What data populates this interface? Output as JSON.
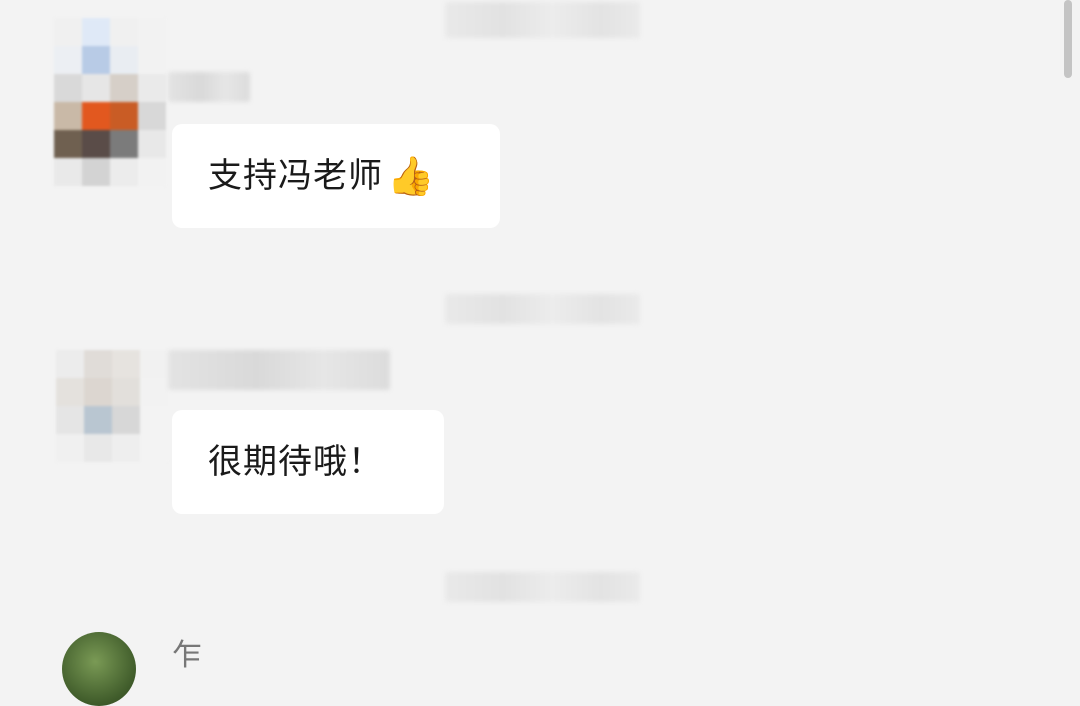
{
  "messages": [
    {
      "text": "支持冯老师",
      "emoji": "👍"
    },
    {
      "text": "很期待哦！"
    }
  ],
  "partial_next": {
    "name_glyph": "乍"
  },
  "colors": {
    "background": "#f3f3f3",
    "bubble": "#ffffff",
    "text": "#1a1a1a"
  }
}
